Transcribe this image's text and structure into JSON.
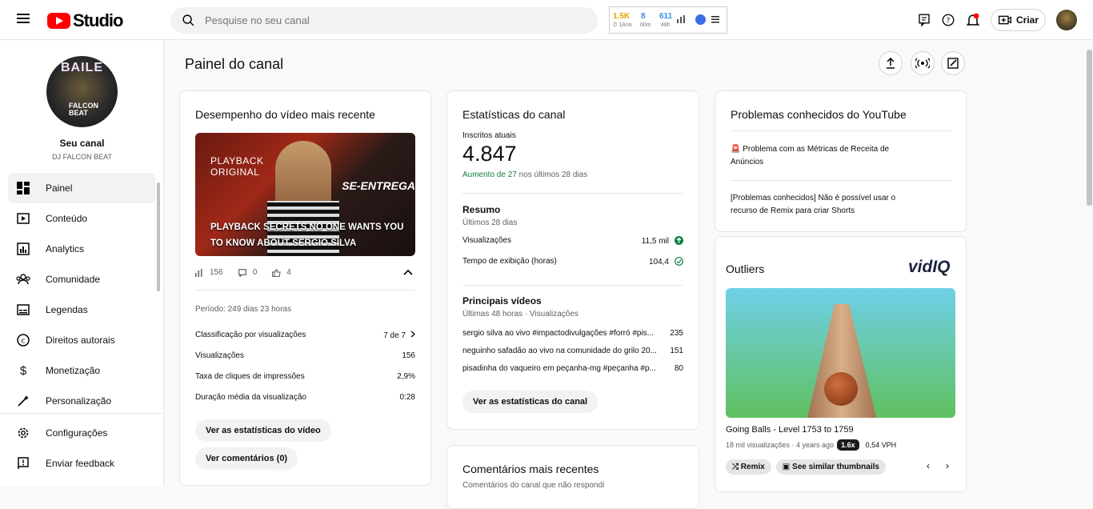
{
  "topbar": {
    "logo_text": "Studio",
    "search_placeholder": "Pesquise no seu canal",
    "ext": {
      "v1": "1.5K",
      "l1": "1Ano",
      "v2": "8",
      "l2": "60m",
      "v3": "611",
      "l3": "48h"
    },
    "create_label": "Criar"
  },
  "sidebar": {
    "channel_title": "Seu canal",
    "channel_name": "DJ FALCON BEAT",
    "avatar_text": "BAILE",
    "avatar_sub": "FALCON BEAT",
    "items": [
      {
        "label": "Painel"
      },
      {
        "label": "Conteúdo"
      },
      {
        "label": "Analytics"
      },
      {
        "label": "Comunidade"
      },
      {
        "label": "Legendas"
      },
      {
        "label": "Direitos autorais"
      },
      {
        "label": "Monetização"
      },
      {
        "label": "Personalização"
      }
    ],
    "bottom": [
      {
        "label": "Configurações"
      },
      {
        "label": "Enviar feedback"
      }
    ]
  },
  "main": {
    "page_title": "Painel do canal",
    "latest": {
      "title": "Desempenho do vídeo mais recente",
      "thumb_badge": "PLAYBACK ORIGINAL",
      "thumb_side": "SE-ENTREGA",
      "thumb_caption": "PLAYBACK SECRETS NO ONE WANTS YOU TO KNOW ABOUT SERGIO SILVA",
      "views": "156",
      "comments": "0",
      "likes": "4",
      "period": "Período: 249 dias 23 horas",
      "rows": [
        {
          "label": "Classificação por visualizações",
          "value": "7 de 7"
        },
        {
          "label": "Visualizações",
          "value": "156"
        },
        {
          "label": "Taxa de cliques de impressões",
          "value": "2,9%"
        },
        {
          "label": "Duração média da visualização",
          "value": "0:28"
        }
      ],
      "btn_stats": "Ver as estatísticas do vídeo",
      "btn_comments": "Ver comentários (0)"
    },
    "stats": {
      "title": "Estatísticas do canal",
      "subs_label": "Inscritos atuais",
      "subs_value": "4.847",
      "subs_increase": "Aumento de 27",
      "subs_period": "nos últimos 28 dias",
      "summary_title": "Resumo",
      "summary_period": "Últimos 28 dias",
      "summary_rows": [
        {
          "label": "Visualizações",
          "value": "11,5 mil"
        },
        {
          "label": "Tempo de exibição (horas)",
          "value": "104,4"
        }
      ],
      "top_title": "Principais vídeos",
      "top_period": "Últimas 48 horas · Visualizações",
      "top_rows": [
        {
          "label": "sergio silva ao vivo #impactodivulgações #forró #pis...",
          "value": "235"
        },
        {
          "label": "neguinho safadão ao vivo na comunidade do grilo 20...",
          "value": "151"
        },
        {
          "label": "pisadinha do vaqueiro em peçanha-mg #peçanha #p...",
          "value": "80"
        }
      ],
      "btn": "Ver as estatísticas do canal"
    },
    "comments": {
      "title": "Comentários mais recentes",
      "subtitle": "Comentários do canal que não respondi"
    },
    "issues": {
      "title": "Problemas conhecidos do YouTube",
      "items": [
        "🚨 Problema com as Métricas de Receita de Anúncios",
        "[Problemas conhecidos] Não é possível usar o recurso de Remix para criar Shorts"
      ]
    },
    "outliers": {
      "title": "Outliers",
      "brand": "vidIQ",
      "video_title": "Going Balls - Level 1753 to 1759",
      "meta": "18 mil visualizações · 4 years ago",
      "multiplier": "1.6x",
      "vph": "0,54 VPH",
      "tag1": "Remix",
      "tag2": "See similar thumbnails"
    }
  }
}
